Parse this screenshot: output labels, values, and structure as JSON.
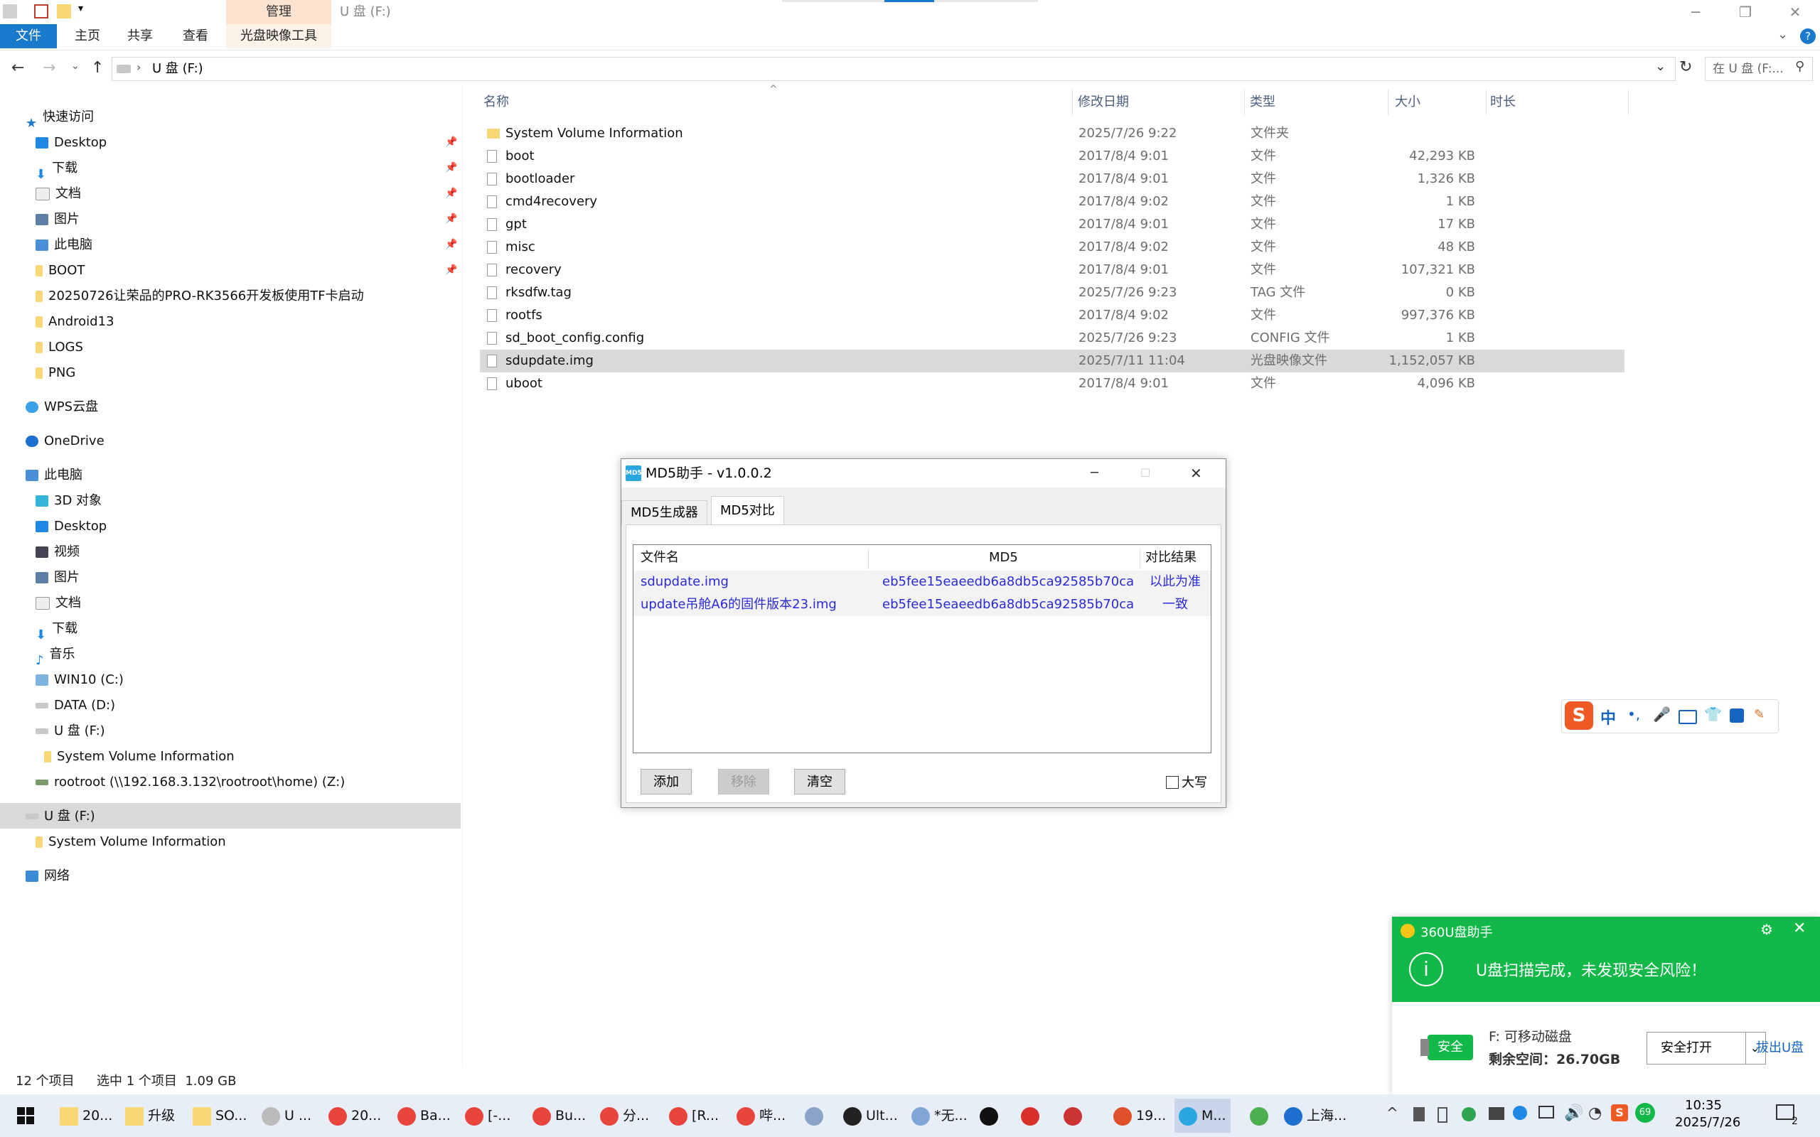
{
  "window": {
    "title": "U 盘 (F:)",
    "context_tab": "管理",
    "ribbon_tabs": [
      "文件",
      "主页",
      "共享",
      "查看",
      "光盘映像工具"
    ],
    "address": "U 盘 (F:)",
    "search_placeholder": "在 U 盘 (F:..."
  },
  "nav": {
    "quick_access": "快速访问",
    "quick_items": [
      "Desktop",
      "下载",
      "文档",
      "图片",
      "此电脑",
      "BOOT",
      "20250726让荣品的PRO-RK3566开发板使用TF卡启动",
      "Android13",
      "LOGS",
      "PNG"
    ],
    "wps": "WPS云盘",
    "onedrive": "OneDrive",
    "this_pc": "此电脑",
    "pc_items": [
      "3D 对象",
      "Desktop",
      "视频",
      "图片",
      "文档",
      "下载",
      "音乐",
      "WIN10 (C:)",
      "DATA (D:)",
      "U 盘 (F:)",
      "System Volume Information",
      "rootroot (\\\\192.168.3.132\\rootroot\\home) (Z:)"
    ],
    "usb": "U 盘 (F:)",
    "usb_child": "System Volume Information",
    "network": "网络"
  },
  "columns": {
    "name": "名称",
    "date": "修改日期",
    "type": "类型",
    "size": "大小",
    "duration": "时长"
  },
  "files": [
    {
      "name": "System Volume Information",
      "date": "2025/7/26 9:22",
      "type": "文件夹",
      "size": "",
      "folder": true
    },
    {
      "name": "boot",
      "date": "2017/8/4 9:01",
      "type": "文件",
      "size": "42,293 KB"
    },
    {
      "name": "bootloader",
      "date": "2017/8/4 9:01",
      "type": "文件",
      "size": "1,326 KB"
    },
    {
      "name": "cmd4recovery",
      "date": "2017/8/4 9:02",
      "type": "文件",
      "size": "1 KB"
    },
    {
      "name": "gpt",
      "date": "2017/8/4 9:01",
      "type": "文件",
      "size": "17 KB"
    },
    {
      "name": "misc",
      "date": "2017/8/4 9:02",
      "type": "文件",
      "size": "48 KB"
    },
    {
      "name": "recovery",
      "date": "2017/8/4 9:01",
      "type": "文件",
      "size": "107,321 KB"
    },
    {
      "name": "rksdfw.tag",
      "date": "2025/7/26 9:23",
      "type": "TAG 文件",
      "size": "0 KB"
    },
    {
      "name": "rootfs",
      "date": "2017/8/4 9:02",
      "type": "文件",
      "size": "997,376 KB"
    },
    {
      "name": "sd_boot_config.config",
      "date": "2025/7/26 9:23",
      "type": "CONFIG 文件",
      "size": "1 KB"
    },
    {
      "name": "sdupdate.img",
      "date": "2025/7/11 11:04",
      "type": "光盘映像文件",
      "size": "1,152,057 KB",
      "selected": true
    },
    {
      "name": "uboot",
      "date": "2017/8/4 9:01",
      "type": "文件",
      "size": "4,096 KB"
    }
  ],
  "status": {
    "count": "12 个项目",
    "selection": "选中 1 个项目  1.09 GB"
  },
  "md5": {
    "title": "MD5助手 - v1.0.0.2",
    "logo": "MD5",
    "tabs": [
      "MD5生成器",
      "MD5对比"
    ],
    "headers": [
      "文件名",
      "MD5",
      "对比结果"
    ],
    "rows": [
      {
        "file": "sdupdate.img",
        "md5": "eb5fee15eaeedb6a8db5ca92585b70ca",
        "result": "以此为准"
      },
      {
        "file": "update吊舱A6的固件版本23.img",
        "md5": "eb5fee15eaeedb6a8db5ca92585b70ca",
        "result": "一致"
      }
    ],
    "buttons": {
      "add": "添加",
      "remove": "移除",
      "clear": "清空"
    },
    "uppercase": "大写"
  },
  "ime": {
    "lang": "中",
    "punct": "•,"
  },
  "n360": {
    "app": "360U盘助手",
    "message": "U盘扫描完成，未发现安全风险！",
    "badge": "安全",
    "drive": "F: 可移动磁盘",
    "free": "剩余空间：26.70GB",
    "open": "安全打开",
    "eject": "拔出U盘"
  },
  "taskbar": {
    "items": [
      "20...",
      "升级",
      "SO...",
      "U ...",
      "20...",
      "Ba...",
      "[-...",
      "Bu...",
      "分...",
      "[R...",
      "哔...",
      "",
      "Ult...",
      "*无...",
      "",
      "",
      "",
      "19...",
      "M...",
      "",
      "上海..."
    ],
    "time": "10:35",
    "date": "2025/7/26",
    "notif": "2",
    "badge_num": "69"
  },
  "colors": {
    "accent": "#1979ca",
    "green360": "#12b949",
    "md5_link": "#2a2ad8",
    "selection": "#d9d9d9"
  }
}
